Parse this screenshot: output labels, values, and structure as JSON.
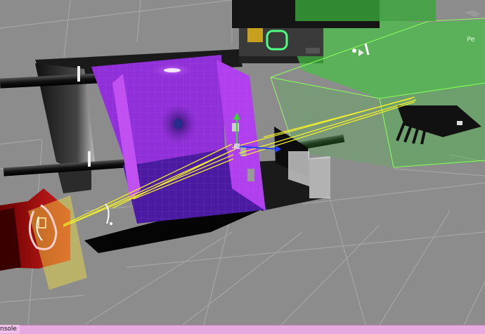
{
  "scene_view": {
    "gizmo_label": "Pe"
  },
  "status_bar": {
    "console_tab": "nsole"
  },
  "colors": {
    "floor": "#8c8c8c",
    "grid_line": "#a6a6a6",
    "room_purple": "#8a2bd0",
    "room_floor": "#3a1a7a",
    "green_volume": "#3fbf3f",
    "laser": "#f2ef2a",
    "red_emitter": "#b01010",
    "status_bar": "#e8a8e0"
  }
}
